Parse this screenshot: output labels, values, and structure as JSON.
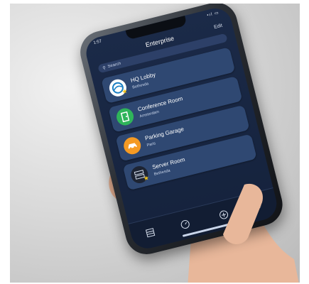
{
  "status": {
    "time": "1:57",
    "icons": "•ıl ▭"
  },
  "header": {
    "title": "Enterprise",
    "edit_label": "Edit"
  },
  "search": {
    "placeholder": "Search"
  },
  "locations": [
    {
      "name": "HQ Lobby",
      "location": "Bethesda",
      "icon": "globe-icon",
      "color": "#ffffff",
      "favorite": true
    },
    {
      "name": "Conference Room",
      "location": "Amsterdam",
      "icon": "door-icon",
      "color": "#2fb45a",
      "favorite": false
    },
    {
      "name": "Parking Garage",
      "location": "Paris",
      "icon": "car-icon",
      "color": "#f59a23",
      "favorite": false
    },
    {
      "name": "Server Room",
      "location": "Bethesda",
      "icon": "server-icon",
      "color": "#1d2433",
      "favorite": true
    }
  ],
  "tabbar": {
    "items": [
      "list-icon",
      "gauge-icon",
      "add-icon",
      "gear-icon"
    ]
  },
  "colors": {
    "screen_bg": "#1b2a48",
    "card_bg": "#2f4872",
    "favorite_star": "#f5c518"
  }
}
